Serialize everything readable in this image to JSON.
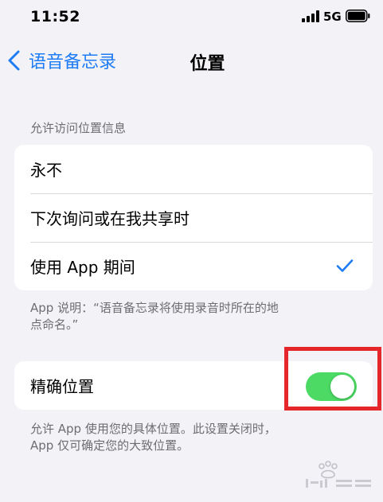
{
  "status_bar": {
    "time": "11:52",
    "network": "5G",
    "icons": [
      "signal-icon",
      "battery-icon"
    ]
  },
  "nav": {
    "back_label": "语音备忘录",
    "title": "位置"
  },
  "access_section": {
    "header": "允许访问位置信息",
    "options": [
      {
        "label": "永不",
        "selected": false
      },
      {
        "label": "下次询问或在我共享时",
        "selected": false
      },
      {
        "label": "使用 App 期间",
        "selected": true
      }
    ],
    "footer_line1": "App 说明：“语音备忘录将使用录音时所在的地",
    "footer_line2": "点命名。”"
  },
  "precise_section": {
    "label": "精确位置",
    "enabled": true,
    "footer_line1": "允许 App 使用您的具体位置。此设置关闭时，",
    "footer_line2": "App 仅可确定您的大致位置。"
  },
  "colors": {
    "accent": "#1e7cf4",
    "toggle_on": "#4cd964",
    "annotation": "#e5262a",
    "background": "#f2f2f7"
  }
}
